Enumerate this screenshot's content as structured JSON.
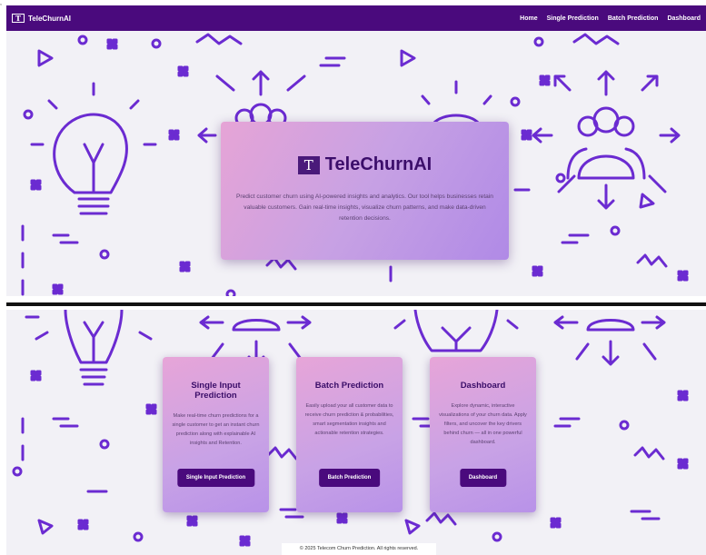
{
  "nav": {
    "brand": "TeleChurnAI",
    "brand_logo_glyph": "T",
    "links": [
      "Home",
      "Single Prediction",
      "Batch Prediction",
      "Dashboard"
    ]
  },
  "hero": {
    "logo_glyph": "T",
    "title": "TeleChurnAI",
    "description": "Predict customer churn using AI-powered insights and analytics. Our tool helps businesses retain valuable customers. Gain real-time insights, visualize churn patterns, and make data-driven retention decisions."
  },
  "cards": [
    {
      "title": "Single Input Prediction",
      "description": "Make real-time churn predictions for a single customer to get an instant churn prediction along with explainable AI insights and Retention.",
      "button": "Single Input Prediction"
    },
    {
      "title": "Batch Prediction",
      "description": "Easily upload your all customer data to receive churn prediction & probabilities, smart segmentation insights and actionable retention strategies.",
      "button": "Batch Prediction"
    },
    {
      "title": "Dashboard",
      "description": "Explore dynamic, interactive visualizations of your churn data. Apply filters, and uncover the key drivers behind churn — all in one powerful dashboard.",
      "button": "Dashboard"
    }
  ],
  "footer": "© 2025 Telecom Churn Prediction. All rights reserved.",
  "colors": {
    "navbar": "#4a0a7d",
    "pattern": "#6b2bd1",
    "background": "#f2f1f6",
    "button": "#4a0a7d"
  },
  "icons": [
    "lightbulb-icon",
    "users-icon",
    "arrow-icon",
    "zigzag-icon",
    "triangle-icon",
    "circle-icon"
  ]
}
